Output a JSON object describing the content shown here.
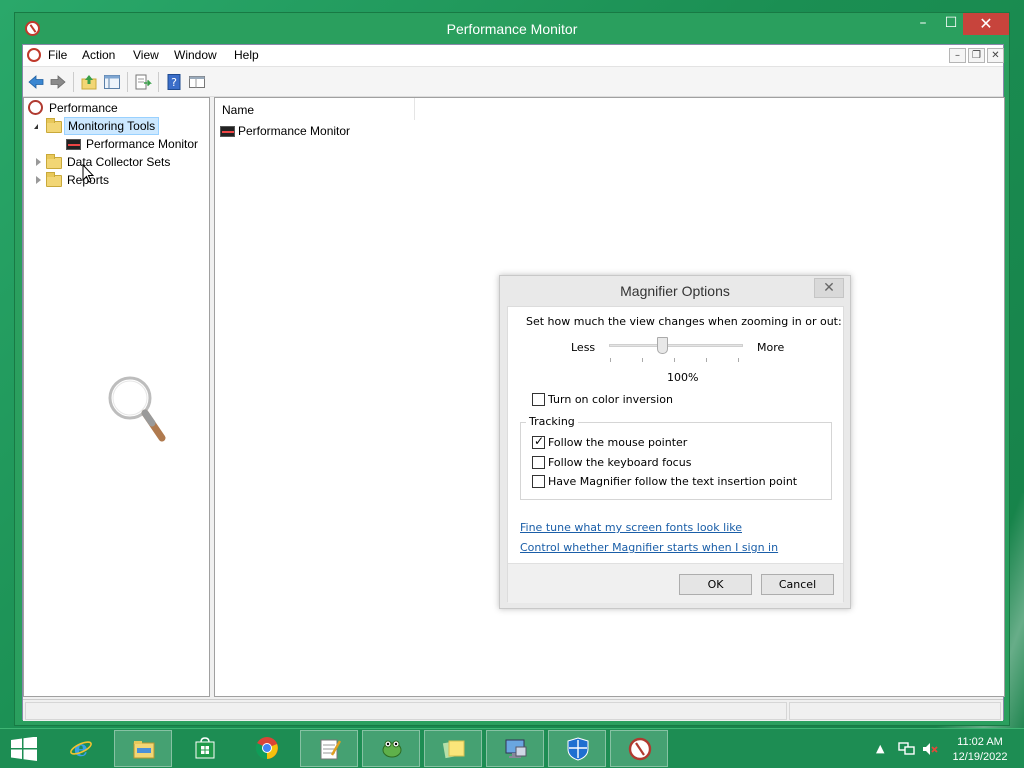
{
  "window": {
    "title": "Performance Monitor",
    "min_glyph": "–",
    "max_glyph": "☐",
    "close_glyph": "✕"
  },
  "menu": {
    "items": [
      "File",
      "Action",
      "View",
      "Window",
      "Help"
    ],
    "mdi_min": "–",
    "mdi_restore": "❐",
    "mdi_close": "✕"
  },
  "tree": {
    "root": "Performance",
    "monitoring_tools": "Monitoring Tools",
    "performance_monitor": "Performance Monitor",
    "data_collector_sets": "Data Collector Sets",
    "reports": "Reports"
  },
  "list": {
    "column_name": "Name",
    "rows": [
      "Performance Monitor"
    ]
  },
  "dialog": {
    "title": "Magnifier Options",
    "close_glyph": "✕",
    "zoom_prompt": "Set how much the view changes when zooming in or out:",
    "less_label": "Less",
    "more_label": "More",
    "zoom_value": "100%",
    "zoom_level_fraction": 0.4,
    "color_inversion_label": "Turn on color inversion",
    "color_inversion_checked": false,
    "tracking_legend": "Tracking",
    "follow_mouse_label": "Follow the mouse pointer",
    "follow_mouse_checked": true,
    "follow_keyboard_label": "Follow the keyboard focus",
    "follow_keyboard_checked": false,
    "follow_text_label": "Have Magnifier follow the text insertion point",
    "follow_text_checked": false,
    "link_fonts": "Fine tune what my screen fonts look like",
    "link_signin": "Control whether Magnifier starts when I sign in",
    "ok_label": "OK",
    "cancel_label": "Cancel"
  },
  "taskbar": {
    "time": "11:02 AM",
    "date": "12/19/2022",
    "apps": [
      "internet-explorer-icon",
      "file-explorer-icon",
      "store-icon",
      "chrome-icon",
      "notepad-icon",
      "frogger-icon",
      "sticky-notes-icon",
      "remote-desktop-icon",
      "defender-icon",
      "performance-monitor-icon"
    ]
  },
  "colors": {
    "accent_green": "#1d8d53",
    "close_red": "#c7443c",
    "link_blue": "#1a5ea8",
    "selection_blue": "#cce8ff"
  }
}
